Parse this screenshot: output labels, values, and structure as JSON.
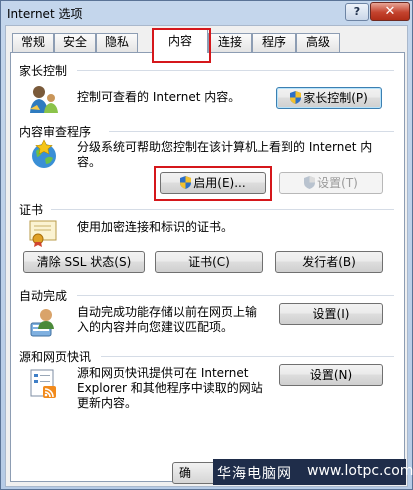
{
  "window": {
    "title": "Internet 选项",
    "help": "?",
    "close": "✕"
  },
  "tabs": [
    "常规",
    "安全",
    "隐私",
    "内容",
    "连接",
    "程序",
    "高级"
  ],
  "active_tab": "内容",
  "parental": {
    "title": "家长控制",
    "description": "控制可查看的 Internet 内容。",
    "button": "家长控制(P)"
  },
  "advisor": {
    "title": "内容审查程序",
    "description_line1": "分级系统可帮助您控制在该计算机上看到的 Internet 内",
    "description_line2": "容。",
    "enable_button": "启用(E)...",
    "settings_button": "设置(T)"
  },
  "certificates": {
    "title": "证书",
    "description": "使用加密连接和标识的证书。",
    "clear_ssl_button": "清除 SSL 状态(S)",
    "certificates_button": "证书(C)",
    "publishers_button": "发行者(B)"
  },
  "autocomplete": {
    "title": "自动完成",
    "description_line1": "自动完成功能存储以前在网页上输",
    "description_line2": "入的内容并向您建议匹配项。",
    "settings_button": "设置(I)"
  },
  "feeds": {
    "title": "源和网页快讯",
    "description_line1": "源和网页快讯提供可在 Internet",
    "description_line2": "Explorer 和其他程序中读取的网站",
    "description_line3": "更新内容。",
    "settings_button": "设置(N)"
  },
  "footer": {
    "ok_button": "确"
  },
  "watermark": {
    "brand": "华海电脑网",
    "url": "www.lotpc.com"
  },
  "colors": {
    "highlight": "#d5171b",
    "title_bar": "#c4d6ec",
    "close": "#c4432e"
  },
  "icons": {
    "parental": "parental-control-icon",
    "advisor": "content-advisor-icon",
    "certificates": "certificate-icon",
    "autocomplete": "autocomplete-icon",
    "feeds": "feeds-icon",
    "shield": "uac-shield-icon"
  }
}
